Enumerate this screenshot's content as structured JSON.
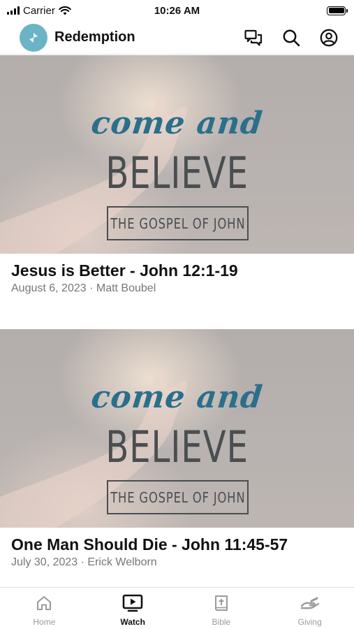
{
  "status_bar": {
    "carrier": "Carrier",
    "time": "10:26 AM"
  },
  "header": {
    "app_title": "Redemption",
    "logo_color": "#6bb4c5",
    "icons": [
      "chat-icon",
      "search-icon",
      "profile-icon"
    ]
  },
  "feed": {
    "items": [
      {
        "artwork": {
          "script": "come and",
          "title": "BELIEVE",
          "subtitle": "THE GOSPEL OF JOHN"
        },
        "title": "Jesus is Better - John 12:1-19",
        "meta": "August 6, 2023 · Matt Boubel"
      },
      {
        "artwork": {
          "script": "come and",
          "title": "BELIEVE",
          "subtitle": "THE GOSPEL OF JOHN"
        },
        "title": "One Man Should Die - John 11:45-57",
        "meta": "July 30, 2023 · Erick Welborn"
      }
    ]
  },
  "tab_bar": {
    "tabs": [
      {
        "label": "Home",
        "icon": "home-icon",
        "active": false
      },
      {
        "label": "Watch",
        "icon": "tv-icon",
        "active": true
      },
      {
        "label": "Bible",
        "icon": "bible-icon",
        "active": false
      },
      {
        "label": "Giving",
        "icon": "giving-icon",
        "active": false
      }
    ]
  },
  "colors": {
    "accent_script": "#2a6f8c",
    "artwork_text": "#4a4e50",
    "meta_text": "#767676",
    "inactive_tab": "#9a9a9a"
  }
}
